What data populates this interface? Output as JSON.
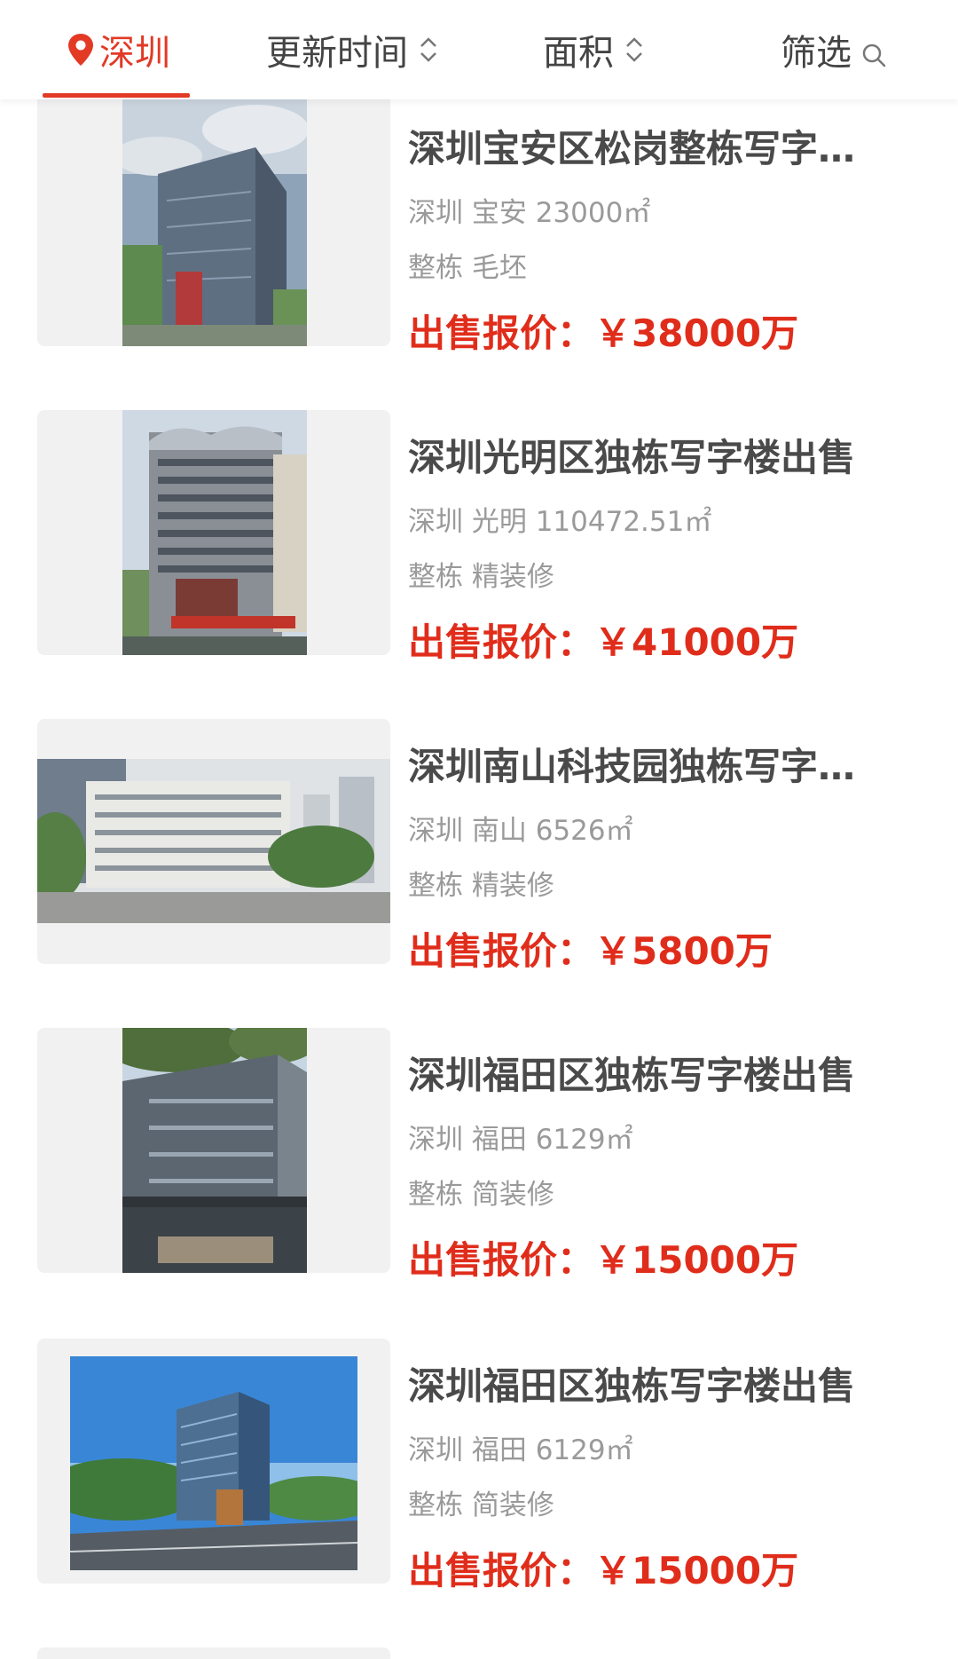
{
  "tabs": {
    "city": "深圳",
    "update_time": "更新时间",
    "area": "面积",
    "filter": "筛选"
  },
  "colors": {
    "accent": "#e23a25",
    "price": "#e02d1b",
    "muted": "#9a9a9a"
  },
  "listings": [
    {
      "title": "深圳宝安区松岗整栋写字楼出售",
      "location": "深圳 宝安 23000㎡",
      "kind": "整栋 毛坯",
      "price_label": "出售报价：",
      "price": "￥38000万"
    },
    {
      "title": "深圳光明区独栋写字楼出售",
      "location": "深圳 光明 110472.51㎡",
      "kind": "整栋 精装修",
      "price_label": "出售报价：",
      "price": "￥41000万"
    },
    {
      "title": "深圳南山科技园独栋写字楼出售",
      "location": "深圳 南山 6526㎡",
      "kind": "整栋 精装修",
      "price_label": "出售报价：",
      "price": "￥5800万"
    },
    {
      "title": "深圳福田区独栋写字楼出售",
      "location": "深圳 福田 6129㎡",
      "kind": "整栋 简装修",
      "price_label": "出售报价：",
      "price": "￥15000万"
    },
    {
      "title": "深圳福田区独栋写字楼出售",
      "location": "深圳 福田 6129㎡",
      "kind": "整栋 简装修",
      "price_label": "出售报价：",
      "price": "￥15000万"
    }
  ]
}
